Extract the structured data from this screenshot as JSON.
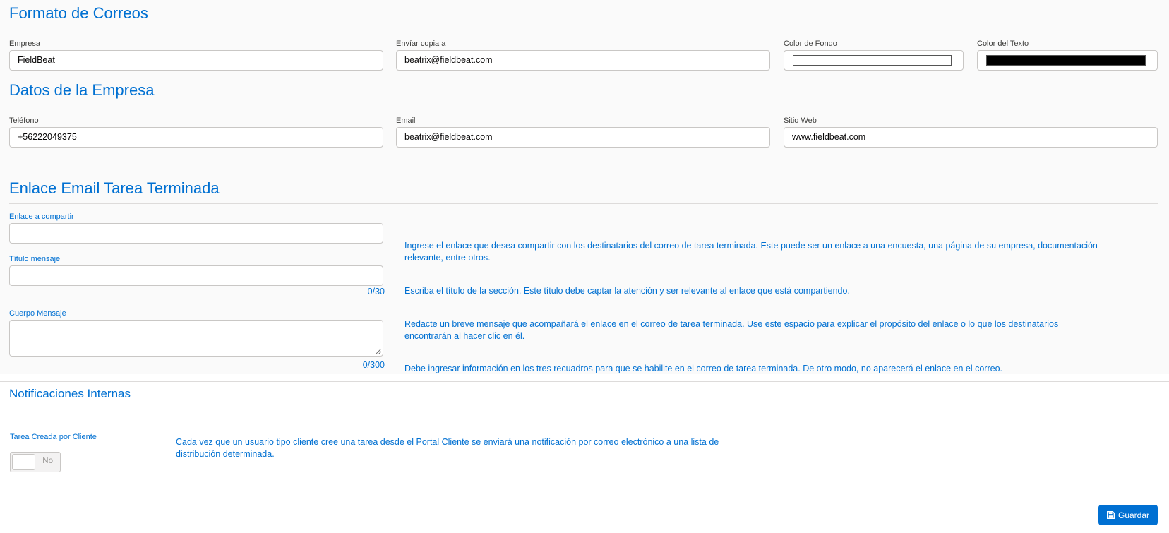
{
  "colors": {
    "accent": "#0070d2",
    "background_top": "#fafafa",
    "background_bottom": "#ffffff",
    "fondo_value": "#ffffff",
    "texto_value": "#000000"
  },
  "formato": {
    "title": "Formato de Correos",
    "empresa_label": "Empresa",
    "empresa_value": "FieldBeat",
    "copia_label": "Envíar copia a",
    "copia_value": "beatrix@fieldbeat.com",
    "fondo_label": "Color de Fondo",
    "texto_label": "Color del Texto"
  },
  "datos": {
    "title": "Datos de la Empresa",
    "telefono_label": "Teléfono",
    "telefono_value": "+56222049375",
    "email_label": "Email",
    "email_value": "beatrix@fieldbeat.com",
    "sitio_label": "Sitio Web",
    "sitio_value": "www.fieldbeat.com"
  },
  "enlace": {
    "title": "Enlace Email Tarea Terminada",
    "enlace_label": "Enlace a compartir",
    "enlace_value": "",
    "titulo_label": "Título mensaje",
    "titulo_value": "",
    "titulo_counter": "0/30",
    "cuerpo_label": "Cuerpo Mensaje",
    "cuerpo_value": "",
    "cuerpo_counter": "0/300",
    "help_enlace": "Ingrese el enlace que desea compartir con los destinatarios del correo de tarea terminada. Este puede ser un enlace a una encuesta, una página de su empresa, documentación relevante, entre otros.",
    "help_titulo": "Escriba el título de la sección. Este título debe captar la atención y ser relevante al enlace que está compartiendo.",
    "help_cuerpo": "Redacte un breve mensaje que acompañará el enlace en el correo de tarea terminada. Use este espacio para explicar el propósito del enlace o lo que los destinatarios encontrarán al hacer clic en él.",
    "help_note": "Debe ingresar información en los tres recuadros para que se habilite en el correo de tarea terminada. De otro modo, no aparecerá el enlace en el correo."
  },
  "notificaciones": {
    "title": "Notificaciones Internas",
    "tarea_label": "Tarea Creada por Cliente",
    "toggle_text": "No",
    "help": "Cada vez que un usuario tipo cliente cree una tarea desde el Portal Cliente se enviará una notificación por correo electrónico a una lista de distribución determinada."
  },
  "actions": {
    "save_label": "Guardar",
    "save_icon": "floppy-disk-icon"
  }
}
